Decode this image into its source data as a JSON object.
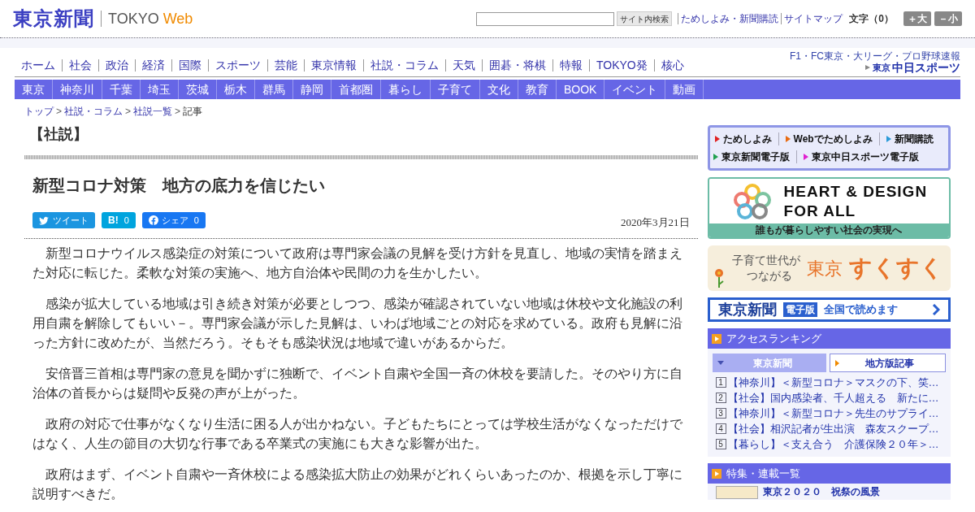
{
  "header": {
    "logo": "東京新聞",
    "logo_sub_1": "TOKYO",
    "logo_sub_2": "Web",
    "search_button": "サイト内検索",
    "links": [
      "ためしよみ・新聞購読",
      "サイトマップ"
    ],
    "font_size_label": "文字（0）",
    "font_buttons": [
      "＋大",
      "－小"
    ]
  },
  "nav": [
    "ホーム",
    "社会",
    "政治",
    "経済",
    "国際",
    "スポーツ",
    "芸能",
    "東京情報",
    "社説・コラム",
    "天気",
    "囲碁・将棋",
    "特報",
    "TOKYO発",
    "核心"
  ],
  "sports_banner": {
    "caption": "F1・FC東京・大リーグ・プロ野球速報",
    "title_1": "東京",
    "title_2": "中日スポーツ"
  },
  "regions": [
    "東京",
    "神奈川",
    "千葉",
    "埼玉",
    "茨城",
    "栃木",
    "群馬",
    "静岡",
    "首都圏",
    "暮らし",
    "子育て",
    "文化",
    "教育",
    "BOOK",
    "イベント",
    "動画"
  ],
  "breadcrumb": [
    {
      "label": "トップ"
    },
    {
      "separator": ">",
      "label": "社説・コラム"
    },
    {
      "separator": ">",
      "label": "社説一覧"
    },
    {
      "separator": ">",
      "label": "記事"
    }
  ],
  "article": {
    "section": "【社説】",
    "headline": "新型コロナ対策　地方の底力を信じたい",
    "share_buttons": [
      {
        "kind": "twitter",
        "label": "ツイート"
      },
      {
        "kind": "hatena",
        "label": "B!",
        "count": "0"
      },
      {
        "kind": "facebook",
        "label": "シェア",
        "count": "0"
      }
    ],
    "date": "2020年3月21日",
    "paragraphs": [
      "新型コロナウイルス感染症の対策について政府は専門家会議の見解を受け方針を見直し、地域の実情を踏まえた対応に転じた。柔軟な対策の実施へ、地方自治体や民間の力を生かしたい。",
      "感染が拡大している地域は引き続き対策が必要としつつ、感染が確認されていない地域は休校や文化施設の利用自粛を解除してもいい－。専門家会議が示した見解は、いわば地域ごとの対応を求めている。政府も見解に沿った方針に改めたが、当然だろう。そもそも感染状況は地域で違いがあるからだ。",
      "安倍晋三首相は専門家の意見を聞かずに独断で、イベント自粛や全国一斉の休校を要請した。そのやり方に自治体の首長からは疑問や反発の声が上がった。",
      "政府の対応で仕事がなくなり生活に困る人が出かねない。子どもたちにとっては学校生活がなくなっただけではなく、人生の節目の大切な行事である卒業式の実施にも大きな影響が出た。",
      "政府はまず、イベント自粛や一斉休校による感染拡大防止の効果がどれくらいあったのか、根拠を示し丁寧に説明すべきだ。"
    ]
  },
  "sidebar": {
    "quick_links": [
      [
        {
          "label": "ためしよみ",
          "color": "#e02020"
        },
        {
          "label": "Webでためしよみ",
          "color": "#e86a10"
        },
        {
          "label": "新聞購読",
          "color": "#2a9ad8"
        }
      ],
      [
        {
          "label": "東京新聞電子版",
          "color": "#20a050"
        },
        {
          "label": "東京中日スポーツ電子版",
          "color": "#e020d0"
        }
      ]
    ],
    "heart_banner": {
      "line_1": "HEART & DESIGN",
      "line_2": "FOR ALL",
      "caption": "誰もが暮らしやすい社会の実現へ"
    },
    "sukusuku_banner": {
      "tagline_1": "子育て世代が",
      "tagline_2": "つながる",
      "title_1": "東京",
      "title_2": "すくすく"
    },
    "epaper_banner": {
      "logo": "東京新聞",
      "badge": "電子版",
      "text": "全国で読めます"
    },
    "ranking": {
      "title": "アクセスランキング",
      "tabs": [
        {
          "label": "東京新聞",
          "selected": true
        },
        {
          "label": "地方版記事",
          "selected": false
        }
      ],
      "items": [
        {
          "rank": "1",
          "text": "【神奈川】＜新型コロナ＞マスクの下、笑…"
        },
        {
          "rank": "2",
          "text": "【社会】国内感染者、千人超える　新たに…"
        },
        {
          "rank": "3",
          "text": "【神奈川】＜新型コロナ＞先生のサプライ…"
        },
        {
          "rank": "4",
          "text": "【社会】相沢記者が生出演　森友スクープ…"
        },
        {
          "rank": "5",
          "text": "【暮らし】＜支え合う　介護保険２０年＞…"
        }
      ]
    },
    "features": {
      "title": "特集・連載一覧",
      "items": [
        "東京２０２０　祝祭の風景"
      ]
    }
  }
}
